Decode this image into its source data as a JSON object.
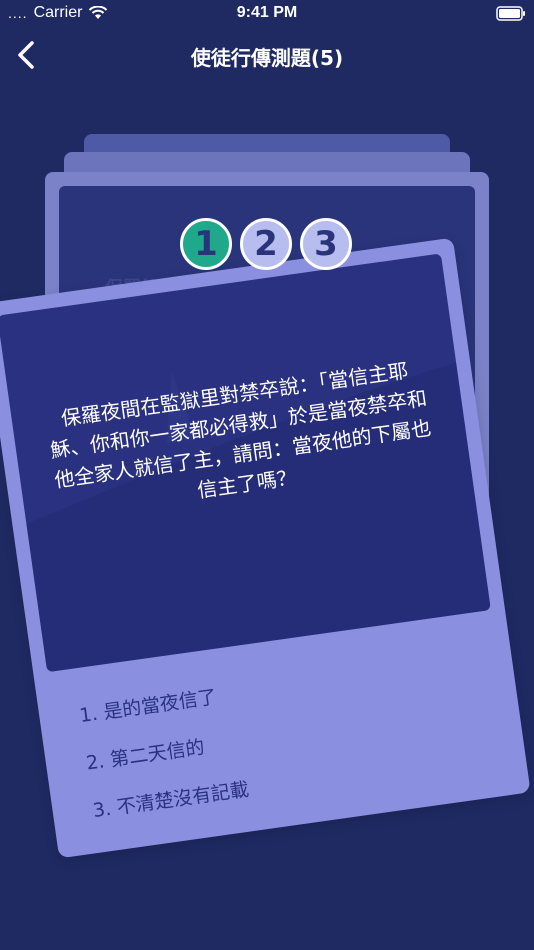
{
  "status_bar": {
    "signal": "....",
    "carrier": "Carrier",
    "time": "9:41 PM"
  },
  "nav": {
    "title": "使徒行傳測題(5)"
  },
  "background_hint": "保羅第二",
  "badges": [
    {
      "label": "1",
      "color": "#1fa88a",
      "active": true
    },
    {
      "label": "2",
      "color": "#b8bdf0",
      "active": false
    },
    {
      "label": "3",
      "color": "#b8bdf0",
      "active": false
    }
  ],
  "question": {
    "text": "保羅夜間在監獄里對禁卒說：「當信主耶穌、你和你一家都必得救」於是當夜禁卒和他全家人就信了主，請問：當夜他的下屬也信主了嗎？"
  },
  "options": [
    "1. 是的當夜信了",
    "2. 第二天信的",
    "3. 不清楚沒有記載"
  ],
  "colors": {
    "background": "#1f2a63",
    "card": "#8b8fe0",
    "panel": "#2a3180",
    "accent": "#1fa88a"
  }
}
